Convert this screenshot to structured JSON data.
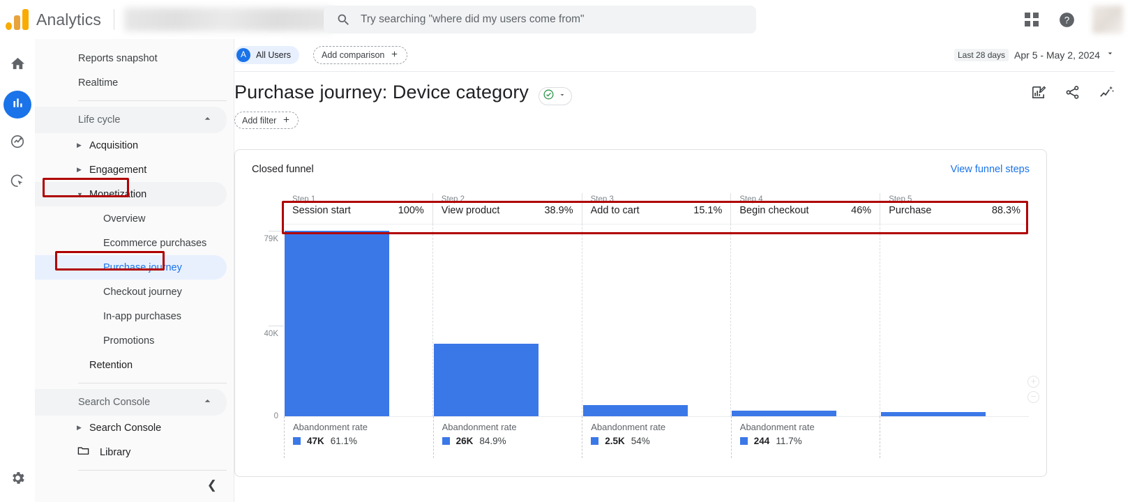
{
  "topbar": {
    "brand": "Analytics",
    "search_placeholder": "Try searching \"where did my users come from\"",
    "apps_icon": "apps-grid-icon",
    "help_icon": "help-icon",
    "avatar": "user-avatar"
  },
  "rail": {
    "items": [
      {
        "name": "home-icon",
        "label": "Home"
      },
      {
        "name": "reports-icon",
        "label": "Reports"
      },
      {
        "name": "explore-icon",
        "label": "Explore"
      },
      {
        "name": "advertising-icon",
        "label": "Advertising"
      }
    ],
    "settings": "Admin"
  },
  "sidebar": {
    "top_items": [
      "Reports snapshot",
      "Realtime"
    ],
    "life_cycle": {
      "label": "Life cycle",
      "groups": [
        {
          "label": "Acquisition",
          "expanded": false
        },
        {
          "label": "Engagement",
          "expanded": false
        },
        {
          "label": "Monetization",
          "expanded": true,
          "children": [
            "Overview",
            "Ecommerce purchases",
            "Purchase journey",
            "Checkout journey",
            "In-app purchases",
            "Promotions"
          ]
        },
        {
          "label": "Retention",
          "expanded": false
        }
      ]
    },
    "search_console": {
      "label": "Search Console",
      "groups": [
        {
          "label": "Search Console",
          "expanded": false
        }
      ]
    },
    "library": "Library",
    "selected": "Purchase journey",
    "collapse_icon": "chevron-left-icon"
  },
  "comparison": {
    "all_users_initial": "A",
    "all_users_label": "All Users",
    "add_comparison_label": "Add comparison"
  },
  "daterange": {
    "preset": "Last 28 days",
    "range": "Apr 5 - May 2, 2024",
    "caret": "chevron-down-icon"
  },
  "report": {
    "title": "Purchase journey: Device category",
    "validity_icon": "check-circle-icon",
    "title_caret": "chevron-down-icon",
    "add_filter_label": "Add filter",
    "actions": [
      {
        "name": "edit-chart-icon",
        "label": "Customize report"
      },
      {
        "name": "share-icon",
        "label": "Share this report"
      },
      {
        "name": "insights-icon",
        "label": "Insights"
      }
    ]
  },
  "card": {
    "title": "Closed funnel",
    "link": "View funnel steps",
    "abandonment_label": "Abandonment rate",
    "zoom_in_icon": "zoom-in-icon",
    "zoom_out_icon": "zoom-out-icon"
  },
  "chart_data": {
    "type": "bar",
    "title": "Closed funnel",
    "xlabel": "",
    "ylabel": "",
    "ylim": [
      0,
      79000
    ],
    "yticks": [
      "0",
      "40K",
      "79K"
    ],
    "ytick_values": [
      0,
      40000,
      79000
    ],
    "grid": true,
    "legend": "none",
    "categories": [
      "Session start",
      "View product",
      "Add to cart",
      "Begin checkout",
      "Purchase"
    ],
    "step_labels": [
      "Step 1",
      "Step 2",
      "Step 3",
      "Step 4",
      "Step 5"
    ],
    "completion_rates": [
      "100%",
      "38.9%",
      "15.1%",
      "46%",
      "88.3%"
    ],
    "values": [
      77000,
      30000,
      4600,
      2100,
      1800
    ],
    "abandonment": [
      {
        "users": "47K",
        "rate": "61.1%"
      },
      {
        "users": "26K",
        "rate": "84.9%"
      },
      {
        "users": "2.5K",
        "rate": "54%"
      },
      {
        "users": "244",
        "rate": "11.7%"
      },
      {
        "users": "",
        "rate": ""
      }
    ],
    "bar_color": "#3b78e7"
  },
  "colors": {
    "accent": "#1a73e8",
    "bar": "#3b78e7",
    "annotation": "#B00000",
    "logo_orange": "#F9AB00"
  }
}
